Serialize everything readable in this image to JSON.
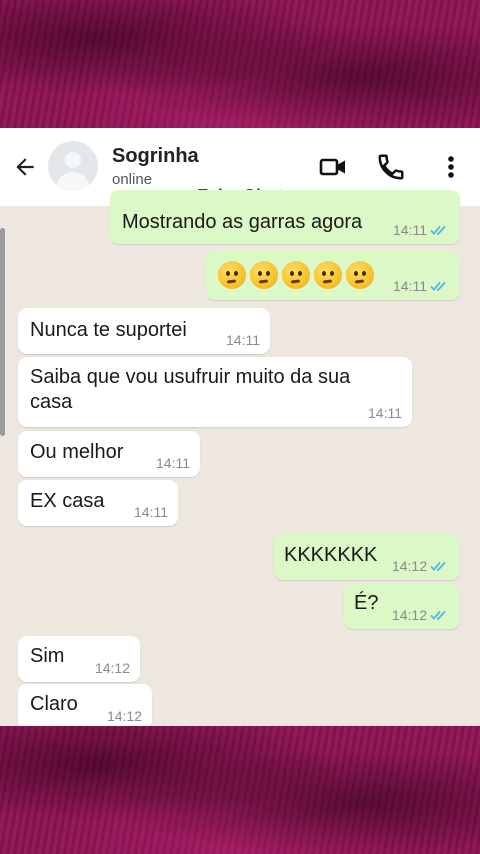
{
  "header": {
    "contact_name": "Sogrinha",
    "status": "online",
    "watermark": "Fake Chat",
    "icons": [
      "back-arrow-icon",
      "avatar-placeholder-icon",
      "video-call-icon",
      "phone-call-icon",
      "more-vertical-icon"
    ]
  },
  "messages": [
    {
      "direction": "out",
      "text": "Mostrando as garras agora",
      "time": "14:11",
      "status": "read"
    },
    {
      "direction": "out",
      "text": "🤔🤔🤔🤔🤔",
      "emoji_count": 5,
      "emoji_name": "thinking-face-emoji",
      "time": "14:11",
      "status": "read"
    },
    {
      "direction": "in",
      "text": "Nunca te suportei",
      "time": "14:11"
    },
    {
      "direction": "in",
      "text": "Saiba que vou usufruir muito da sua",
      "text2": "casa",
      "time": "14:11"
    },
    {
      "direction": "in",
      "text": "Ou melhor",
      "time": "14:11"
    },
    {
      "direction": "in",
      "text": "EX casa",
      "time": "14:11"
    },
    {
      "direction": "out",
      "text": "KKKKKKK",
      "time": "14:12",
      "status": "read"
    },
    {
      "direction": "out",
      "text": "É?",
      "time": "14:12",
      "status": "read"
    },
    {
      "direction": "in",
      "text": "Sim",
      "time": "14:12"
    },
    {
      "direction": "in",
      "text": "Claro",
      "time": "14:12"
    }
  ],
  "colors": {
    "outgoing_bubble": "#dcf8c6",
    "incoming_bubble": "#ffffff",
    "chat_background": "#ede7e0",
    "read_ticks": "#4fb6ec",
    "frame_background": "#8e1253"
  }
}
